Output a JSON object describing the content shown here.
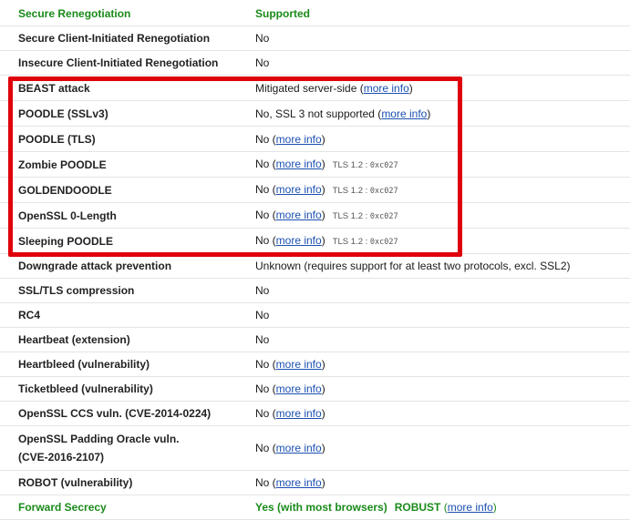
{
  "rows": [
    {
      "label": "Secure Renegotiation",
      "value": "Supported"
    },
    {
      "label": "Secure Client-Initiated Renegotiation",
      "value": "No"
    },
    {
      "label": "Insecure Client-Initiated Renegotiation",
      "value": "No"
    },
    {
      "label": "BEAST attack",
      "value": "Mitigated server-side (",
      "link": "more info",
      "suffix": ")"
    },
    {
      "label": "POODLE (SSLv3)",
      "value": "No, SSL 3 not supported (",
      "link": "more info",
      "suffix": ")"
    },
    {
      "label": "POODLE (TLS)",
      "value": "No (",
      "link": "more info",
      "suffix": ")"
    },
    {
      "label": "Zombie POODLE",
      "value": "No (",
      "link": "more info",
      "suffix": ")",
      "note": "TLS 1.2 :",
      "code": "0xc027"
    },
    {
      "label": "GOLDENDOODLE",
      "value": "No (",
      "link": "more info",
      "suffix": ")",
      "note": "TLS 1.2 :",
      "code": "0xc027"
    },
    {
      "label": "OpenSSL 0-Length",
      "value": "No (",
      "link": "more info",
      "suffix": ")",
      "note": "TLS 1.2 :",
      "code": "0xc027"
    },
    {
      "label": "Sleeping POODLE",
      "value": "No (",
      "link": "more info",
      "suffix": ")",
      "note": "TLS 1.2 :",
      "code": "0xc027"
    },
    {
      "label": "Downgrade attack prevention",
      "value": "Unknown (requires support for at least two protocols, excl. SSL2)"
    },
    {
      "label": "SSL/TLS compression",
      "value": "No"
    },
    {
      "label": "RC4",
      "value": "No"
    },
    {
      "label": "Heartbeat (extension)",
      "value": "No"
    },
    {
      "label": "Heartbleed (vulnerability)",
      "value": "No (",
      "link": "more info",
      "suffix": ")"
    },
    {
      "label": "Ticketbleed (vulnerability)",
      "value": "No (",
      "link": "more info",
      "suffix": ")"
    },
    {
      "label": "OpenSSL CCS vuln. (CVE-2014-0224)",
      "value": "No (",
      "link": "more info",
      "suffix": ")"
    },
    {
      "label": "OpenSSL Padding Oracle vuln. (CVE-2016-2107)",
      "value": "No (",
      "link": "more info",
      "suffix": ")"
    },
    {
      "label": "ROBOT (vulnerability)",
      "value": "No (",
      "link": "more info",
      "suffix": ")"
    },
    {
      "label": "Forward Secrecy",
      "value": "Yes (with most browsers)",
      "extra": "ROBUST",
      "extra_prefix": " (",
      "link": "more info",
      "suffix": ")"
    }
  ],
  "colors": {
    "highlight_text": "#1a8a1a",
    "link": "#1a4fb0",
    "callout_border": "#e0000b"
  }
}
